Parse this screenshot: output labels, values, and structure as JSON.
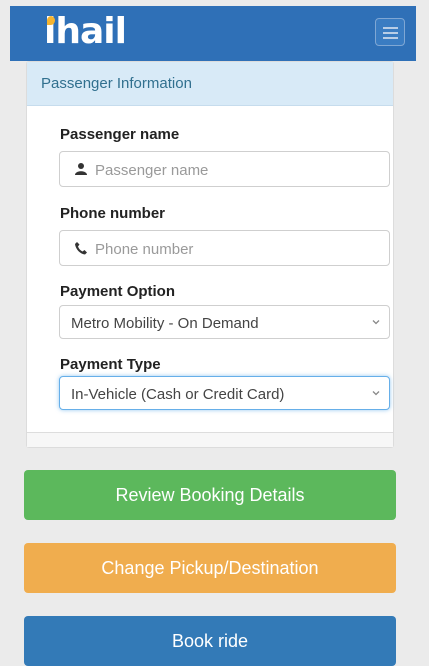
{
  "navbar": {
    "logo_text": "ihail",
    "menu_icon": "hamburger-menu-icon",
    "brand_color": "#2f70b7"
  },
  "panel": {
    "heading": "Passenger Information",
    "passenger_name": {
      "label": "Passenger name",
      "placeholder": "Passenger name",
      "icon": "user-icon"
    },
    "phone": {
      "label": "Phone number",
      "placeholder": "Phone number",
      "icon": "phone-icon"
    },
    "payment_option": {
      "label": "Payment Option",
      "selected": "Metro Mobility - On Demand"
    },
    "payment_type": {
      "label": "Payment Type",
      "selected": "In-Vehicle (Cash or Credit Card)"
    }
  },
  "actions": {
    "review_label": "Review Booking Details",
    "change_label": "Change Pickup/Destination",
    "book_label": "Book ride",
    "colors": {
      "review": "#5cb85c",
      "change": "#f0ad4e",
      "book": "#337ab7"
    }
  }
}
